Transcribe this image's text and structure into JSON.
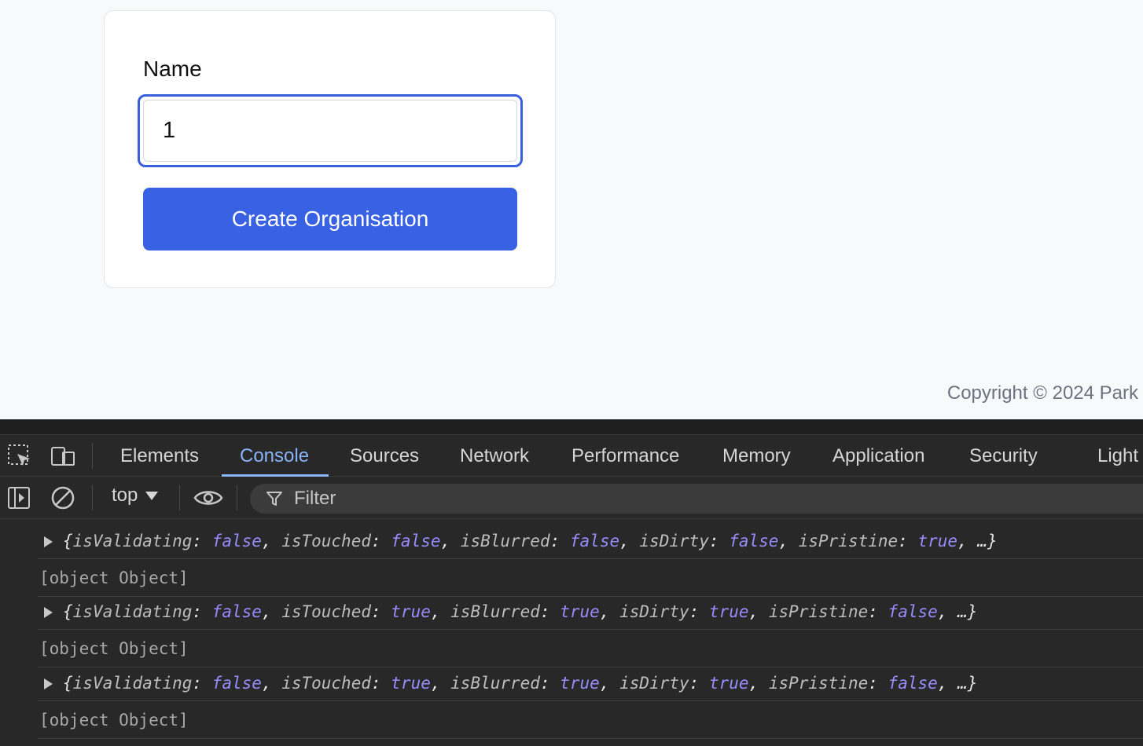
{
  "page": {
    "field_label": "Name",
    "name_value": "1",
    "create_button": "Create Organisation",
    "copyright": "Copyright © 2024 Park"
  },
  "devtools": {
    "tabs": [
      "Elements",
      "Console",
      "Sources",
      "Network",
      "Performance",
      "Memory",
      "Application",
      "Security",
      "Light"
    ],
    "active_tab": "Console",
    "context": "top",
    "filter_placeholder": "Filter",
    "logs": [
      {
        "type": "object",
        "entries": [
          [
            "isValidating",
            "false"
          ],
          [
            "isTouched",
            "false"
          ],
          [
            "isBlurred",
            "false"
          ],
          [
            "isDirty",
            "false"
          ],
          [
            "isPristine",
            "true"
          ]
        ]
      },
      {
        "type": "string",
        "text": "[object Object]"
      },
      {
        "type": "object",
        "entries": [
          [
            "isValidating",
            "false"
          ],
          [
            "isTouched",
            "true"
          ],
          [
            "isBlurred",
            "true"
          ],
          [
            "isDirty",
            "true"
          ],
          [
            "isPristine",
            "false"
          ]
        ]
      },
      {
        "type": "string",
        "text": "[object Object]"
      },
      {
        "type": "object",
        "entries": [
          [
            "isValidating",
            "false"
          ],
          [
            "isTouched",
            "true"
          ],
          [
            "isBlurred",
            "true"
          ],
          [
            "isDirty",
            "true"
          ],
          [
            "isPristine",
            "false"
          ]
        ]
      },
      {
        "type": "string",
        "text": "[object Object]"
      }
    ]
  },
  "colors": {
    "accent": "#3961e3",
    "devtools_bg": "#282828",
    "devtools_active": "#8ab4f8",
    "console_value": "#9a8cff"
  },
  "icons": [
    "inspect-element-icon",
    "device-toolbar-icon",
    "sidebar-toggle-icon",
    "clear-console-icon",
    "eye-icon",
    "filter-icon"
  ]
}
